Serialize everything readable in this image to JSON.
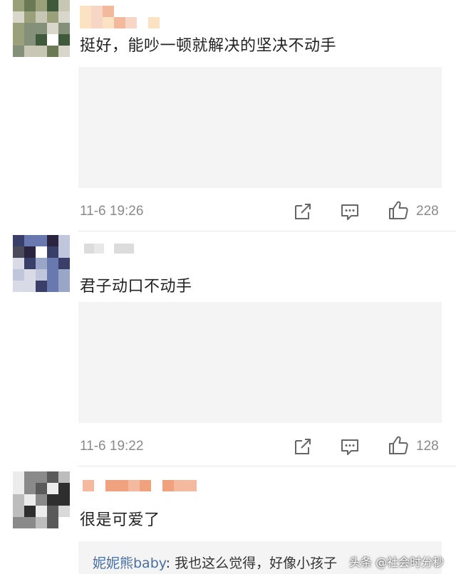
{
  "comments": [
    {
      "text": "挺好，能吵一顿就解决的坚决不动手",
      "time": "11-6 19:26",
      "likes": "228"
    },
    {
      "text": "君子动口不动手",
      "time": "11-6 19:22",
      "likes": "128"
    },
    {
      "text": "很是可爱了"
    }
  ],
  "reply": {
    "user": "妮妮熊baby",
    "text": ": 我也这么觉得，好像小孩子"
  },
  "watermark": "头条 @社会时分秒",
  "icons": {
    "share": "share-icon",
    "comment": "comment-icon",
    "like": "thumbs-up-icon"
  },
  "colors": {
    "username_link": "#4a6fa5",
    "meta_gray": "#8a8a8a",
    "reply_bg": "#f4f4f4"
  }
}
